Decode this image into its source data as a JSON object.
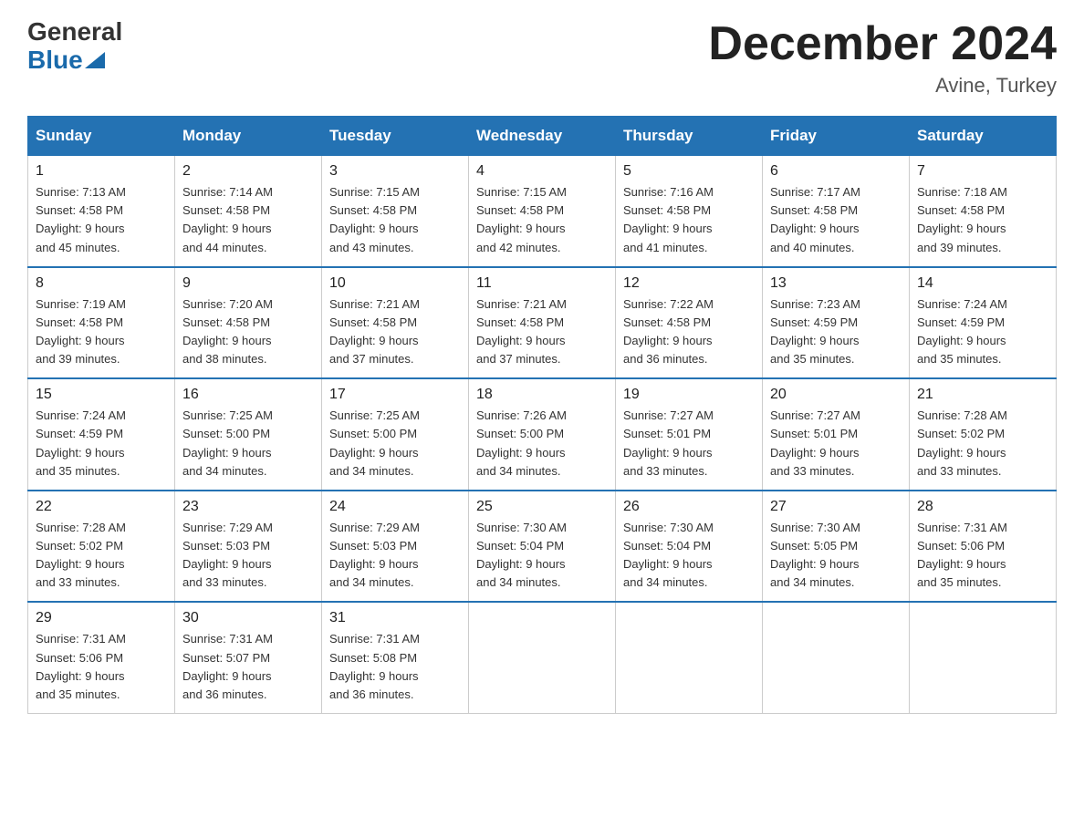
{
  "header": {
    "logo_general": "General",
    "logo_blue": "Blue",
    "month_title": "December 2024",
    "location": "Avine, Turkey"
  },
  "weekdays": [
    "Sunday",
    "Monday",
    "Tuesday",
    "Wednesday",
    "Thursday",
    "Friday",
    "Saturday"
  ],
  "weeks": [
    [
      {
        "day": "1",
        "sunrise": "7:13 AM",
        "sunset": "4:58 PM",
        "daylight": "9 hours and 45 minutes."
      },
      {
        "day": "2",
        "sunrise": "7:14 AM",
        "sunset": "4:58 PM",
        "daylight": "9 hours and 44 minutes."
      },
      {
        "day": "3",
        "sunrise": "7:15 AM",
        "sunset": "4:58 PM",
        "daylight": "9 hours and 43 minutes."
      },
      {
        "day": "4",
        "sunrise": "7:15 AM",
        "sunset": "4:58 PM",
        "daylight": "9 hours and 42 minutes."
      },
      {
        "day": "5",
        "sunrise": "7:16 AM",
        "sunset": "4:58 PM",
        "daylight": "9 hours and 41 minutes."
      },
      {
        "day": "6",
        "sunrise": "7:17 AM",
        "sunset": "4:58 PM",
        "daylight": "9 hours and 40 minutes."
      },
      {
        "day": "7",
        "sunrise": "7:18 AM",
        "sunset": "4:58 PM",
        "daylight": "9 hours and 39 minutes."
      }
    ],
    [
      {
        "day": "8",
        "sunrise": "7:19 AM",
        "sunset": "4:58 PM",
        "daylight": "9 hours and 39 minutes."
      },
      {
        "day": "9",
        "sunrise": "7:20 AM",
        "sunset": "4:58 PM",
        "daylight": "9 hours and 38 minutes."
      },
      {
        "day": "10",
        "sunrise": "7:21 AM",
        "sunset": "4:58 PM",
        "daylight": "9 hours and 37 minutes."
      },
      {
        "day": "11",
        "sunrise": "7:21 AM",
        "sunset": "4:58 PM",
        "daylight": "9 hours and 37 minutes."
      },
      {
        "day": "12",
        "sunrise": "7:22 AM",
        "sunset": "4:58 PM",
        "daylight": "9 hours and 36 minutes."
      },
      {
        "day": "13",
        "sunrise": "7:23 AM",
        "sunset": "4:59 PM",
        "daylight": "9 hours and 35 minutes."
      },
      {
        "day": "14",
        "sunrise": "7:24 AM",
        "sunset": "4:59 PM",
        "daylight": "9 hours and 35 minutes."
      }
    ],
    [
      {
        "day": "15",
        "sunrise": "7:24 AM",
        "sunset": "4:59 PM",
        "daylight": "9 hours and 35 minutes."
      },
      {
        "day": "16",
        "sunrise": "7:25 AM",
        "sunset": "5:00 PM",
        "daylight": "9 hours and 34 minutes."
      },
      {
        "day": "17",
        "sunrise": "7:25 AM",
        "sunset": "5:00 PM",
        "daylight": "9 hours and 34 minutes."
      },
      {
        "day": "18",
        "sunrise": "7:26 AM",
        "sunset": "5:00 PM",
        "daylight": "9 hours and 34 minutes."
      },
      {
        "day": "19",
        "sunrise": "7:27 AM",
        "sunset": "5:01 PM",
        "daylight": "9 hours and 33 minutes."
      },
      {
        "day": "20",
        "sunrise": "7:27 AM",
        "sunset": "5:01 PM",
        "daylight": "9 hours and 33 minutes."
      },
      {
        "day": "21",
        "sunrise": "7:28 AM",
        "sunset": "5:02 PM",
        "daylight": "9 hours and 33 minutes."
      }
    ],
    [
      {
        "day": "22",
        "sunrise": "7:28 AM",
        "sunset": "5:02 PM",
        "daylight": "9 hours and 33 minutes."
      },
      {
        "day": "23",
        "sunrise": "7:29 AM",
        "sunset": "5:03 PM",
        "daylight": "9 hours and 33 minutes."
      },
      {
        "day": "24",
        "sunrise": "7:29 AM",
        "sunset": "5:03 PM",
        "daylight": "9 hours and 34 minutes."
      },
      {
        "day": "25",
        "sunrise": "7:30 AM",
        "sunset": "5:04 PM",
        "daylight": "9 hours and 34 minutes."
      },
      {
        "day": "26",
        "sunrise": "7:30 AM",
        "sunset": "5:04 PM",
        "daylight": "9 hours and 34 minutes."
      },
      {
        "day": "27",
        "sunrise": "7:30 AM",
        "sunset": "5:05 PM",
        "daylight": "9 hours and 34 minutes."
      },
      {
        "day": "28",
        "sunrise": "7:31 AM",
        "sunset": "5:06 PM",
        "daylight": "9 hours and 35 minutes."
      }
    ],
    [
      {
        "day": "29",
        "sunrise": "7:31 AM",
        "sunset": "5:06 PM",
        "daylight": "9 hours and 35 minutes."
      },
      {
        "day": "30",
        "sunrise": "7:31 AM",
        "sunset": "5:07 PM",
        "daylight": "9 hours and 36 minutes."
      },
      {
        "day": "31",
        "sunrise": "7:31 AM",
        "sunset": "5:08 PM",
        "daylight": "9 hours and 36 minutes."
      },
      null,
      null,
      null,
      null
    ]
  ],
  "labels": {
    "sunrise": "Sunrise:",
    "sunset": "Sunset:",
    "daylight": "Daylight:"
  }
}
